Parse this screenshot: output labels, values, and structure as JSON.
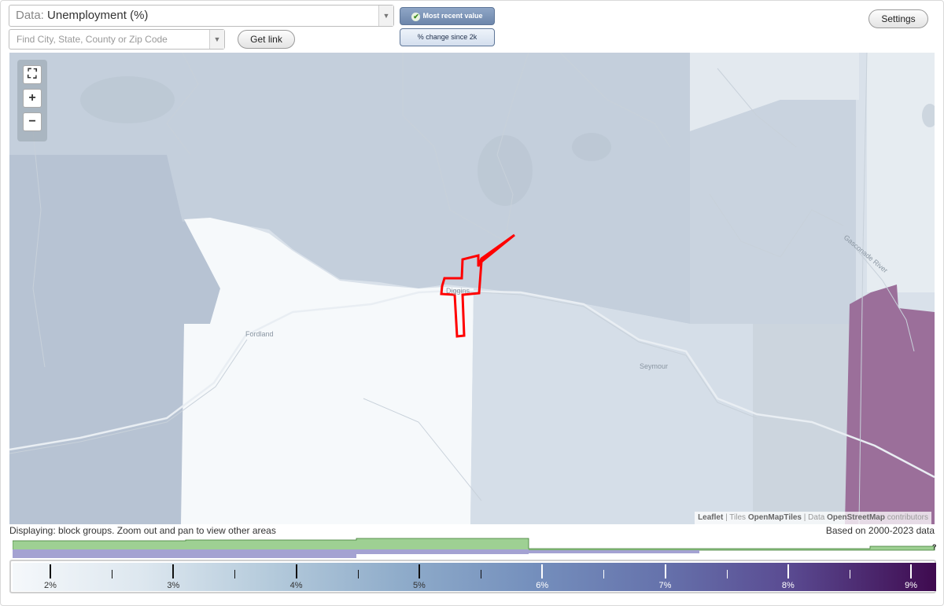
{
  "data_select": {
    "label": "Data:",
    "value": "Unemployment (%)"
  },
  "search": {
    "placeholder": "Find City, State, County or Zip Code"
  },
  "buttons": {
    "get_link": "Get link",
    "settings": "Settings"
  },
  "mode": {
    "most_recent": "Most recent value",
    "change": "% change since 2k",
    "selected": "Most recent value"
  },
  "map": {
    "places": [
      "Diggins",
      "Fordland",
      "Seymour",
      "Gasconade River"
    ],
    "highlight_color": "#ff0000",
    "attribution": {
      "leaflet": "Leaflet",
      "sep1": " | ",
      "tiles_prefix": "Tiles ",
      "tiles": "OpenMapTiles",
      "sep2": " | ",
      "data_prefix": "Data ",
      "data": "OpenStreetMap",
      "contributors": " contributors"
    }
  },
  "status": {
    "displaying": "Displaying: block groups. Zoom out and pan to view other areas",
    "based_on": "Based on 2000-2023 data"
  },
  "histogram": {
    "question_mark": "?"
  },
  "legend": {
    "labels": [
      "2%",
      "3%",
      "4%",
      "5%",
      "6%",
      "7%",
      "8%",
      "9%"
    ]
  },
  "colors": {
    "low": "#f5f8fb",
    "mid": "#7590bd",
    "high": "#3f0a4f",
    "hist_green": "#9ed093",
    "hist_purple": "#a4a2d2"
  }
}
